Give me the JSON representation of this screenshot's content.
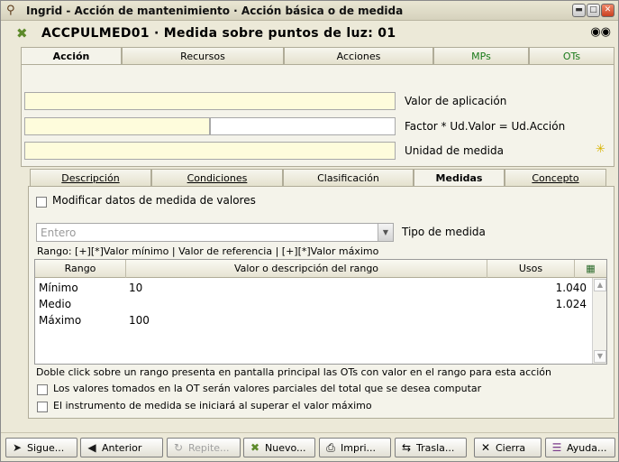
{
  "window": {
    "title": "Ingrid - Acción de mantenimiento · Acción básica o de medida",
    "controls": [
      "minimize-icon",
      "maximize-icon",
      "close-icon"
    ]
  },
  "header": {
    "title": "ACCPULMED01 · Medida sobre puntos de luz: 01"
  },
  "main_tabs": [
    {
      "label": "Acción",
      "active": true
    },
    {
      "label": "Recursos",
      "active": false
    },
    {
      "label": "Acciones",
      "active": false
    },
    {
      "label": "MPs",
      "active": false
    },
    {
      "label": "OTs",
      "active": false
    }
  ],
  "fields": {
    "valor_aplicacion": {
      "value": "",
      "label": "Valor de aplicación"
    },
    "factor": {
      "value1": "",
      "value2": "",
      "label": "Factor * Ud.Valor = Ud.Acción"
    },
    "unidad": {
      "value": "",
      "label": "Unidad de medida"
    }
  },
  "sub_tabs": [
    {
      "label": "Descripción",
      "active": false
    },
    {
      "label": "Condiciones",
      "active": false
    },
    {
      "label": "Clasificación",
      "active": false
    },
    {
      "label": "Medidas",
      "active": true
    },
    {
      "label": "Concepto",
      "active": false
    }
  ],
  "medidas": {
    "modificar_label": "Modificar datos de medida de valores",
    "modificar_checked": false,
    "tipo_value": "Entero",
    "tipo_label": "Tipo de medida",
    "rango_help": "Rango: [+][*]Valor mínimo | Valor de referencia | [+][*]Valor máximo",
    "grid": {
      "columns": [
        "Rango",
        "Valor o descripción del rango",
        "Usos"
      ],
      "rows": [
        {
          "rango": "Mínimo",
          "valor": "10",
          "usos": "1.040"
        },
        {
          "rango": "Medio",
          "valor": "",
          "usos": "1.024"
        },
        {
          "rango": "Máximo",
          "valor": "100",
          "usos": ""
        }
      ]
    },
    "double_click_note": "Doble click sobre un rango presenta en pantalla principal las OTs con valor en el rango para esta acción",
    "check_parciales": "Los valores tomados en la OT serán valores parciales del total que se desea computar",
    "check_instrumento": "El instrumento de medida se iniciará al superar el valor máximo"
  },
  "buttons": [
    {
      "label": "Sigue...",
      "icon": "arrow-right-icon"
    },
    {
      "label": "Anterior",
      "icon": "arrow-left-icon"
    },
    {
      "label": "Repite...",
      "icon": "repeat-icon",
      "disabled": true
    },
    {
      "label": "Nuevo...",
      "icon": "new-icon"
    },
    {
      "label": "Impri...",
      "icon": "printer-icon"
    },
    {
      "label": "Trasla...",
      "icon": "transfer-icon"
    },
    {
      "label": "Cierra",
      "icon": "close-x-icon"
    },
    {
      "label": "Ayuda...",
      "icon": "help-book-icon"
    }
  ]
}
